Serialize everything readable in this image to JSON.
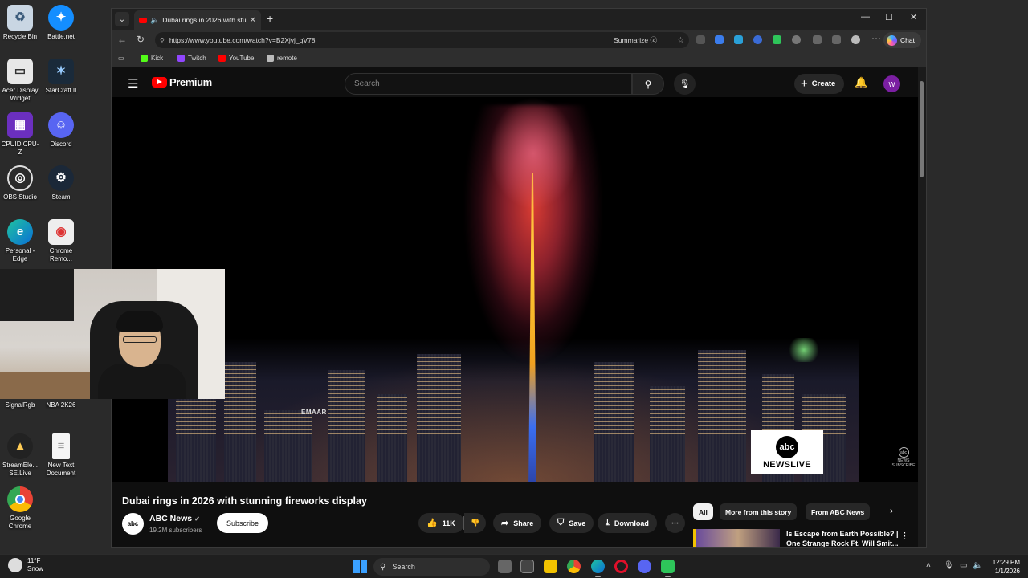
{
  "desktop": {
    "icons": [
      {
        "label": "Recycle Bin",
        "icon": "recycle-bin-icon"
      },
      {
        "label": "Battle.net",
        "icon": "battlenet-icon"
      },
      {
        "label": "Acer Display Widget",
        "icon": "acer-display-widget-icon"
      },
      {
        "label": "StarCraft II",
        "icon": "starcraft-icon"
      },
      {
        "label": "CPUID CPU-Z",
        "icon": "cpuz-icon"
      },
      {
        "label": "Discord",
        "icon": "discord-icon"
      },
      {
        "label": "OBS Studio",
        "icon": "obs-icon"
      },
      {
        "label": "Steam",
        "icon": "steam-icon"
      },
      {
        "label": "Personal - Edge",
        "icon": "edge-icon"
      },
      {
        "label": "Chrome Remo...",
        "icon": "chrome-remote-icon"
      },
      {
        "label": "SignalRgb",
        "icon": "signalrgb-icon"
      },
      {
        "label": "NBA 2K26",
        "icon": "nba2k-icon"
      },
      {
        "label": "StreamEle... SE.Live",
        "icon": "streamelements-icon"
      },
      {
        "label": "New Text Document",
        "icon": "text-document-icon"
      },
      {
        "label": "Google Chrome",
        "icon": "chrome-icon"
      }
    ]
  },
  "browser": {
    "tab_title": "Dubai rings in 2026 with stunn",
    "url": "https://www.youtube.com/watch?v=B2Xjvj_qV78",
    "summarize_label": "Summarize",
    "chat_label": "Chat",
    "favorites": [
      {
        "label": "Kick",
        "color": "#53fc18"
      },
      {
        "label": "Twitch",
        "color": "#9146ff"
      },
      {
        "label": "YouTube",
        "color": "#ff0000"
      },
      {
        "label": "remote",
        "color": "#bbbbbb"
      }
    ]
  },
  "youtube": {
    "logo_text": "Premium",
    "search_placeholder": "Search",
    "create_label": "Create",
    "avatar_letter": "W",
    "video_overlay": {
      "emaar": "EMAAR",
      "abc_circle": "abc",
      "abc_newslive": "NEWSLIVE",
      "corner_abc": "abc",
      "corner_text": "NEWS SUBSCRIBE"
    },
    "video_title": "Dubai rings in 2026 with stunning fireworks display",
    "channel": {
      "name": "ABC News",
      "avatar_text": "abc",
      "subscribers": "19.2M subscribers",
      "subscribe_label": "Subscribe"
    },
    "actions": {
      "likes": "11K",
      "share": "Share",
      "save": "Save",
      "download": "Download"
    },
    "chips": [
      "All",
      "More from this story",
      "From ABC News"
    ],
    "recommendation": {
      "title": "Is Escape from Earth Possible? | One Strange Rock Ft. Will Smit..."
    }
  },
  "taskbar": {
    "weather_temp": "11°F",
    "weather_desc": "Snow",
    "search_label": "Search",
    "time": "12:29 PM",
    "date": "1/1/2026"
  },
  "colors": {
    "yt_red": "#ff0000",
    "yt_bg": "#0f0f0f",
    "taskbar_bg": "#1f1f1f"
  }
}
